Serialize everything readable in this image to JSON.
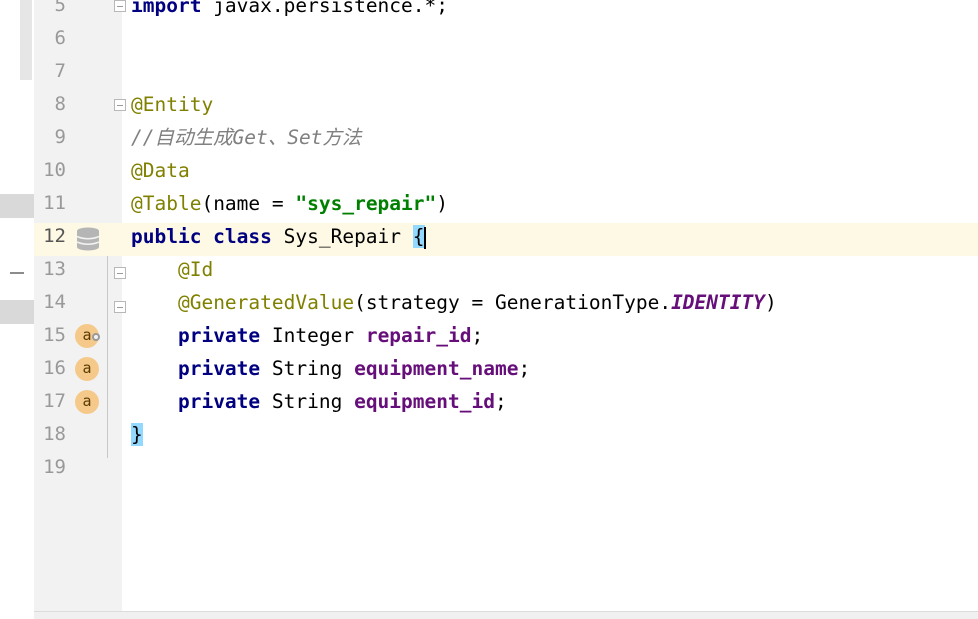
{
  "lines": [
    {
      "n": "5",
      "parts": [
        [
          "kw",
          "import"
        ],
        [
          "plain",
          " javax.persistence.*;"
        ]
      ]
    },
    {
      "n": "6",
      "parts": []
    },
    {
      "n": "7",
      "parts": []
    },
    {
      "n": "8",
      "parts": [
        [
          "anno",
          "@Entity"
        ]
      ]
    },
    {
      "n": "9",
      "parts": [
        [
          "comment",
          "//自动生成Get、Set方法"
        ]
      ]
    },
    {
      "n": "10",
      "parts": [
        [
          "anno",
          "@Data"
        ]
      ]
    },
    {
      "n": "11",
      "parts": [
        [
          "anno",
          "@Table"
        ],
        [
          "plain",
          "(name = "
        ],
        [
          "str",
          "\"sys_repair\""
        ],
        [
          "plain",
          ")"
        ]
      ]
    },
    {
      "n": "12",
      "parts": [
        [
          "kw",
          "public class"
        ],
        [
          "plain",
          " Sys_Repair "
        ],
        [
          "brace",
          "{"
        ]
      ]
    },
    {
      "n": "13",
      "parts": [
        [
          "plain",
          "    "
        ],
        [
          "anno",
          "@Id"
        ]
      ]
    },
    {
      "n": "14",
      "parts": [
        [
          "plain",
          "    "
        ],
        [
          "anno",
          "@GeneratedValue"
        ],
        [
          "plain",
          "(strategy = GenerationType."
        ],
        [
          "italic-const",
          "IDENTITY"
        ],
        [
          "plain",
          ")"
        ]
      ]
    },
    {
      "n": "15",
      "parts": [
        [
          "plain",
          "    "
        ],
        [
          "kw",
          "private"
        ],
        [
          "plain",
          " Integer "
        ],
        [
          "field",
          "repair_id"
        ],
        [
          "plain",
          ";"
        ]
      ]
    },
    {
      "n": "16",
      "parts": [
        [
          "plain",
          "    "
        ],
        [
          "kw",
          "private"
        ],
        [
          "plain",
          " String "
        ],
        [
          "field",
          "equipment_name"
        ],
        [
          "plain",
          ";"
        ]
      ]
    },
    {
      "n": "17",
      "parts": [
        [
          "plain",
          "    "
        ],
        [
          "kw",
          "private"
        ],
        [
          "plain",
          " String "
        ],
        [
          "field",
          "equipment_id"
        ],
        [
          "plain",
          ";"
        ]
      ]
    },
    {
      "n": "18",
      "parts": [
        [
          "brace",
          "}"
        ]
      ]
    },
    {
      "n": "19",
      "parts": []
    }
  ],
  "badges": [
    {
      "line": "15",
      "label": "a",
      "has_key": true
    },
    {
      "line": "16",
      "label": "a",
      "has_key": false
    },
    {
      "line": "17",
      "label": "a",
      "has_key": false
    }
  ],
  "current_line": "12",
  "icons": {
    "db": "database-icon",
    "field": "field-icon",
    "fold": "fold-icon"
  }
}
